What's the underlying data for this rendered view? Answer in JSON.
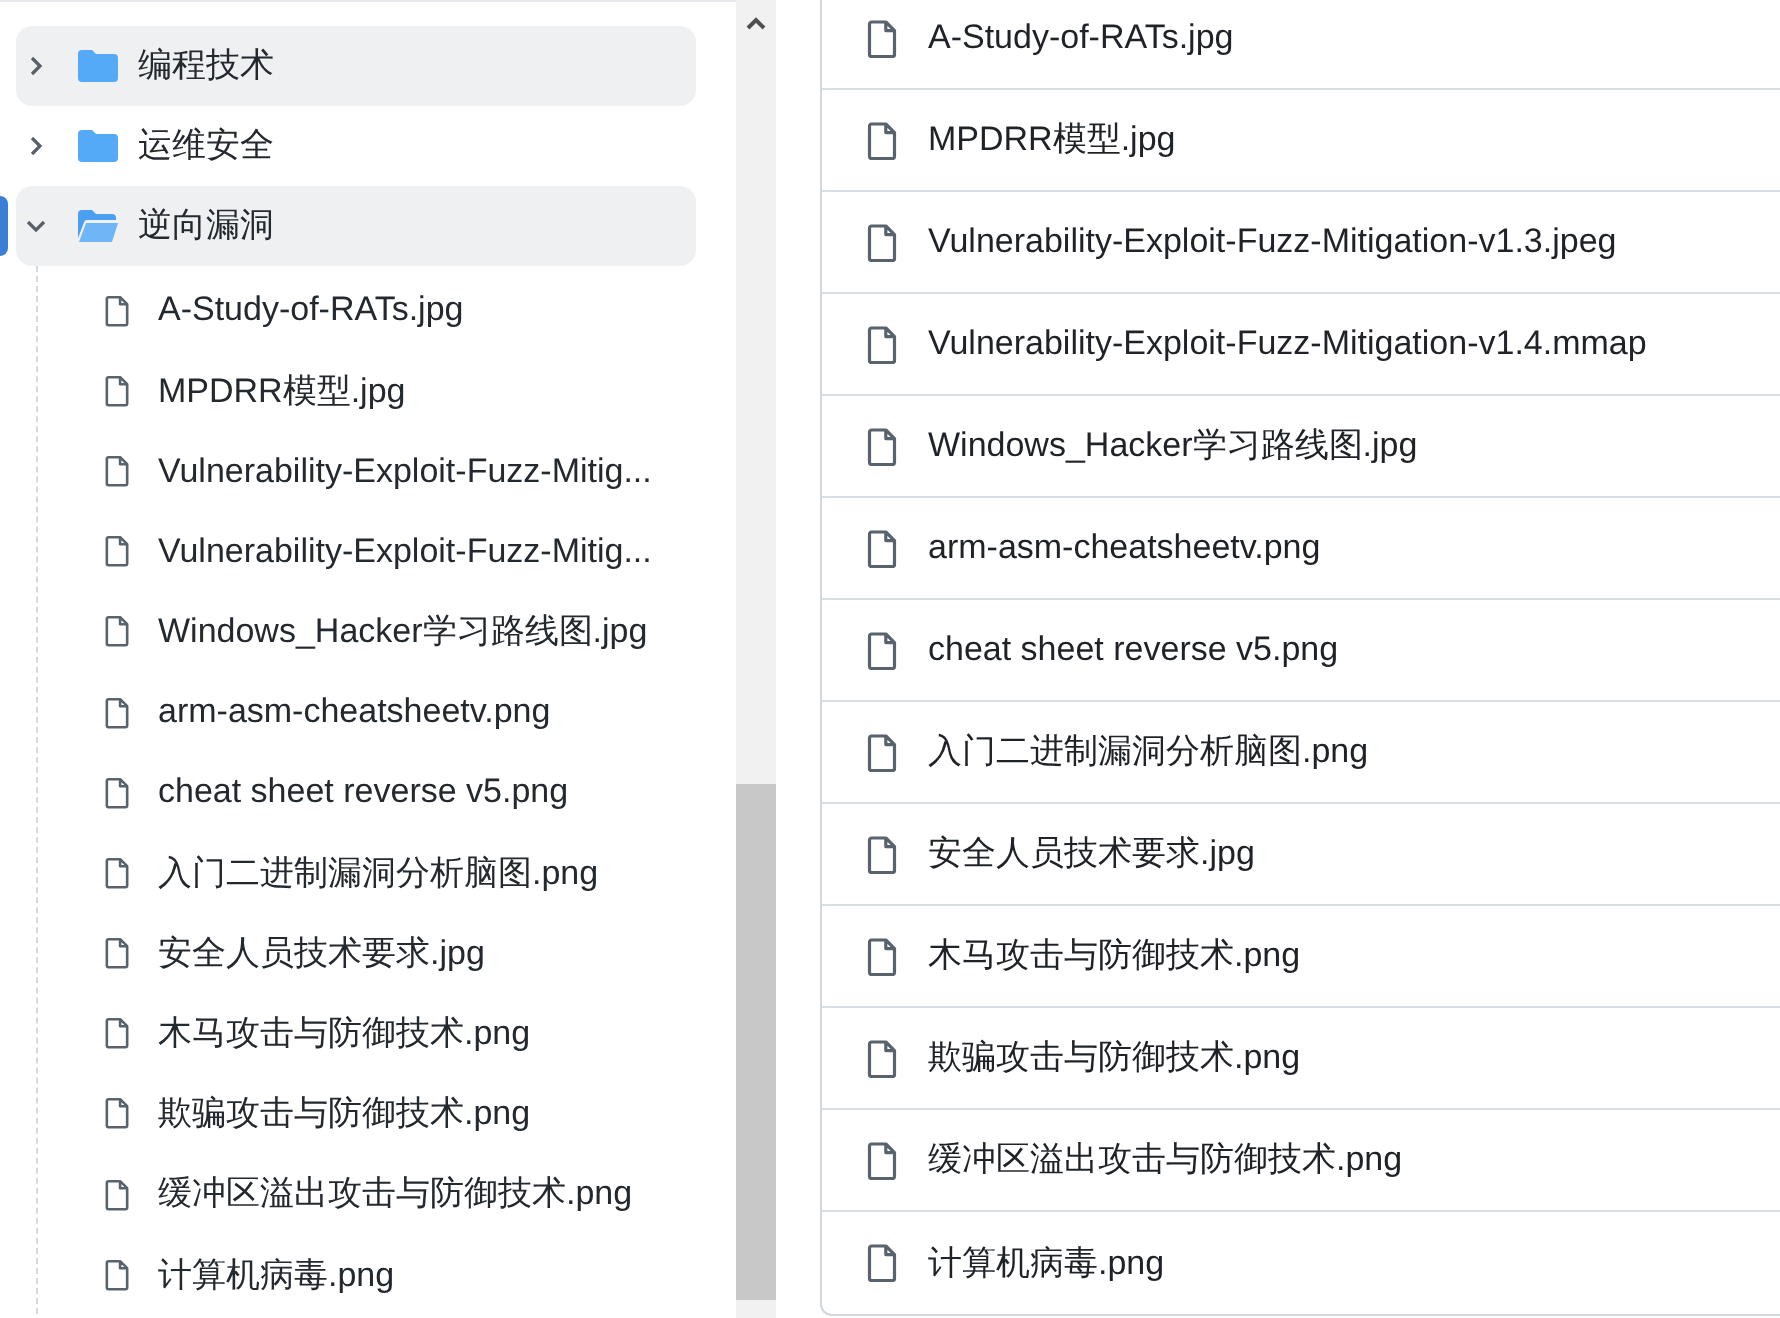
{
  "sidebar": {
    "tree": [
      {
        "kind": "folder",
        "label": "编程技术",
        "expanded": false,
        "selected": false,
        "highlighted": true
      },
      {
        "kind": "folder",
        "label": "运维安全",
        "expanded": false,
        "selected": false,
        "highlighted": false
      },
      {
        "kind": "folder",
        "label": "逆向漏洞",
        "expanded": true,
        "selected": true,
        "highlighted": true,
        "children": [
          {
            "kind": "file",
            "label": "A-Study-of-RATs.jpg"
          },
          {
            "kind": "file",
            "label": "MPDRR模型.jpg"
          },
          {
            "kind": "file",
            "label": "Vulnerability-Exploit-Fuzz-Mitig..."
          },
          {
            "kind": "file",
            "label": "Vulnerability-Exploit-Fuzz-Mitig..."
          },
          {
            "kind": "file",
            "label": "Windows_Hacker学习路线图.jpg"
          },
          {
            "kind": "file",
            "label": "arm-asm-cheatsheetv.png"
          },
          {
            "kind": "file",
            "label": "cheat sheet reverse v5.png"
          },
          {
            "kind": "file",
            "label": "入门二进制漏洞分析脑图.png"
          },
          {
            "kind": "file",
            "label": "安全人员技术要求.jpg"
          },
          {
            "kind": "file",
            "label": "木马攻击与防御技术.png"
          },
          {
            "kind": "file",
            "label": "欺骗攻击与防御技术.png"
          },
          {
            "kind": "file",
            "label": "缓冲区溢出攻击与防御技术.png"
          },
          {
            "kind": "file",
            "label": "计算机病毒.png"
          }
        ]
      }
    ]
  },
  "file_list": {
    "items": [
      {
        "name": "A-Study-of-RATs.jpg"
      },
      {
        "name": "MPDRR模型.jpg"
      },
      {
        "name": "Vulnerability-Exploit-Fuzz-Mitigation-v1.3.jpeg"
      },
      {
        "name": "Vulnerability-Exploit-Fuzz-Mitigation-v1.4.mmap"
      },
      {
        "name": "Windows_Hacker学习路线图.jpg"
      },
      {
        "name": "arm-asm-cheatsheetv.png"
      },
      {
        "name": "cheat sheet reverse v5.png"
      },
      {
        "name": "入门二进制漏洞分析脑图.png"
      },
      {
        "name": "安全人员技术要求.jpg"
      },
      {
        "name": "木马攻击与防御技术.png"
      },
      {
        "name": "欺骗攻击与防御技术.png"
      },
      {
        "name": "缓冲区溢出攻击与防御技术.png"
      },
      {
        "name": "计算机病毒.png"
      }
    ]
  }
}
